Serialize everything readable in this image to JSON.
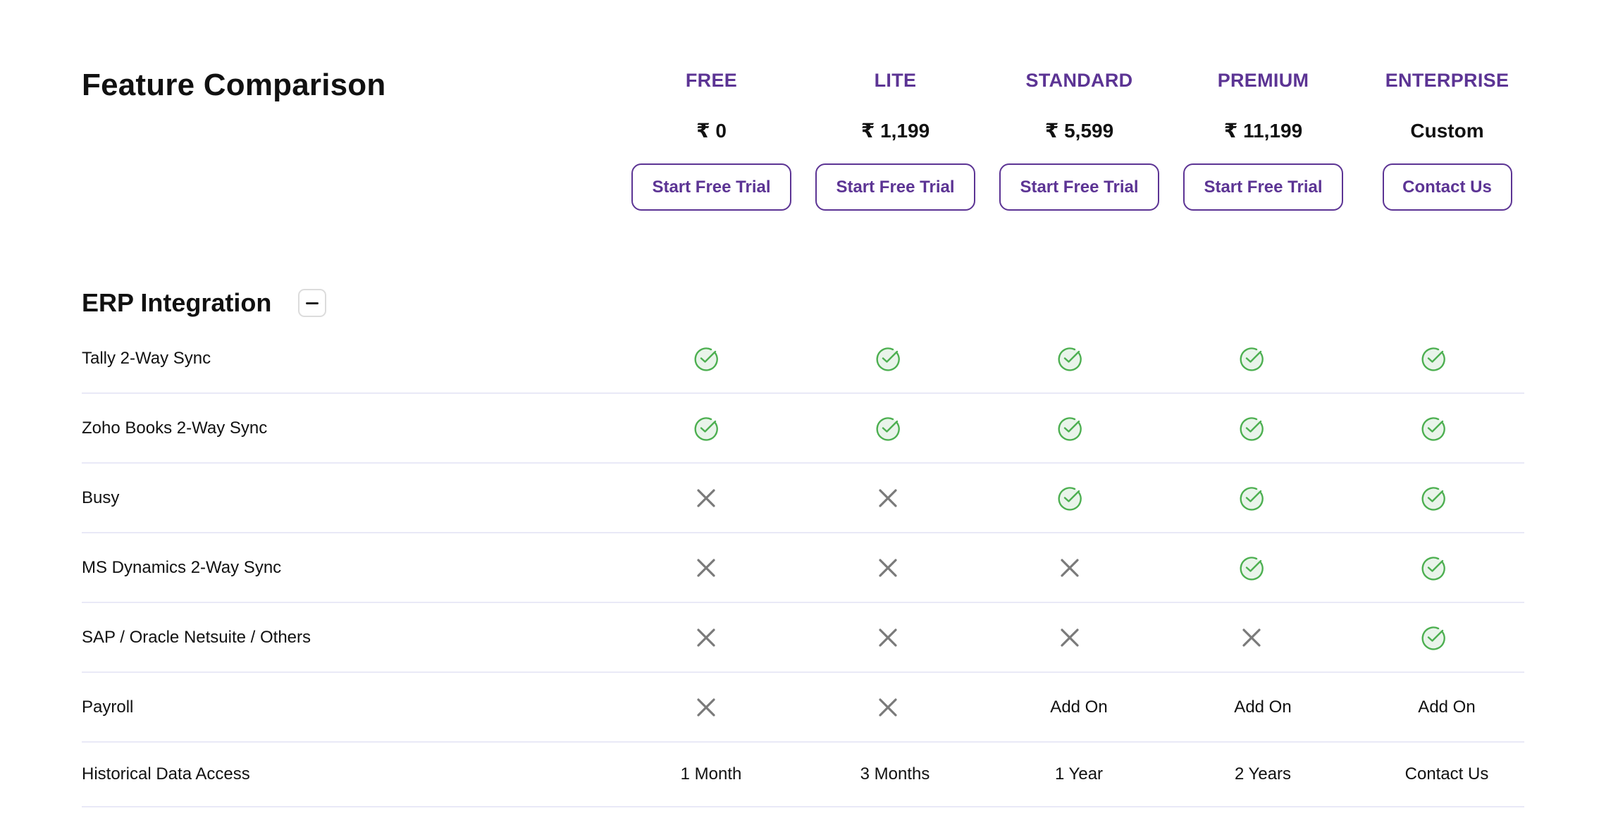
{
  "page": {
    "title": "Feature Comparison"
  },
  "colors": {
    "accent": "#5c3494",
    "check": "#4caf50",
    "check_fill": "#e9f4ea",
    "cross": "#7a7a7a",
    "divider": "#e9e9f7"
  },
  "plans": [
    {
      "name": "FREE",
      "price": "₹ 0",
      "cta": "Start Free Trial"
    },
    {
      "name": "LITE",
      "price": "₹ 1,199",
      "cta": "Start Free Trial"
    },
    {
      "name": "STANDARD",
      "price": "₹ 5,599",
      "cta": "Start Free Trial"
    },
    {
      "name": "PREMIUM",
      "price": "₹ 11,199",
      "cta": "Start Free Trial"
    },
    {
      "name": "ENTERPRISE",
      "price": "Custom",
      "cta": "Contact Us"
    }
  ],
  "section": {
    "title": "ERP Integration",
    "collapse_icon": "minus-icon",
    "rows": [
      {
        "feature": "Tally 2-Way Sync",
        "values": [
          "check",
          "check",
          "check",
          "check",
          "check"
        ]
      },
      {
        "feature": "Zoho Books 2-Way Sync",
        "values": [
          "check",
          "check",
          "check",
          "check",
          "check"
        ]
      },
      {
        "feature": "Busy",
        "values": [
          "cross",
          "cross",
          "check",
          "check",
          "check"
        ]
      },
      {
        "feature": "MS Dynamics 2-Way Sync",
        "values": [
          "cross",
          "cross",
          "cross",
          "check",
          "check"
        ]
      },
      {
        "feature": "SAP / Oracle Netsuite / Others",
        "values": [
          "cross",
          "cross",
          "cross",
          "cross",
          "check"
        ]
      },
      {
        "feature": "Payroll",
        "values": [
          "cross",
          "cross",
          "Add On",
          "Add On",
          "Add On"
        ]
      },
      {
        "feature": "Historical Data Access",
        "values": [
          "1 Month",
          "3 Months",
          "1 Year",
          "2 Years",
          "Contact Us"
        ]
      }
    ]
  }
}
